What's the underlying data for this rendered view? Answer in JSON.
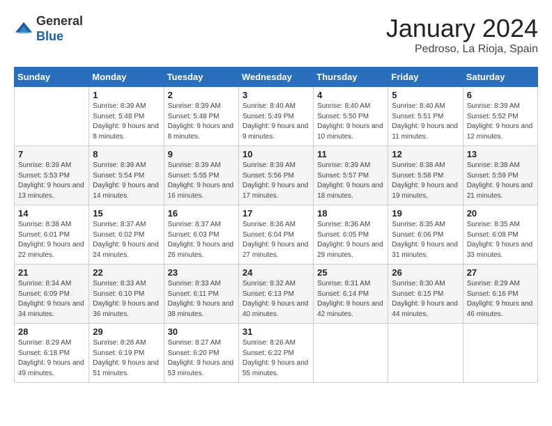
{
  "header": {
    "logo_general": "General",
    "logo_blue": "Blue",
    "month_title": "January 2024",
    "location": "Pedroso, La Rioja, Spain"
  },
  "days_of_week": [
    "Sunday",
    "Monday",
    "Tuesday",
    "Wednesday",
    "Thursday",
    "Friday",
    "Saturday"
  ],
  "weeks": [
    [
      {
        "day": "",
        "empty": true
      },
      {
        "day": "1",
        "sunrise": "Sunrise: 8:39 AM",
        "sunset": "Sunset: 5:48 PM",
        "daylight": "Daylight: 9 hours and 8 minutes."
      },
      {
        "day": "2",
        "sunrise": "Sunrise: 8:39 AM",
        "sunset": "Sunset: 5:48 PM",
        "daylight": "Daylight: 9 hours and 8 minutes."
      },
      {
        "day": "3",
        "sunrise": "Sunrise: 8:40 AM",
        "sunset": "Sunset: 5:49 PM",
        "daylight": "Daylight: 9 hours and 9 minutes."
      },
      {
        "day": "4",
        "sunrise": "Sunrise: 8:40 AM",
        "sunset": "Sunset: 5:50 PM",
        "daylight": "Daylight: 9 hours and 10 minutes."
      },
      {
        "day": "5",
        "sunrise": "Sunrise: 8:40 AM",
        "sunset": "Sunset: 5:51 PM",
        "daylight": "Daylight: 9 hours and 11 minutes."
      },
      {
        "day": "6",
        "sunrise": "Sunrise: 8:39 AM",
        "sunset": "Sunset: 5:52 PM",
        "daylight": "Daylight: 9 hours and 12 minutes."
      }
    ],
    [
      {
        "day": "7",
        "sunrise": "Sunrise: 8:39 AM",
        "sunset": "Sunset: 5:53 PM",
        "daylight": "Daylight: 9 hours and 13 minutes."
      },
      {
        "day": "8",
        "sunrise": "Sunrise: 8:39 AM",
        "sunset": "Sunset: 5:54 PM",
        "daylight": "Daylight: 9 hours and 14 minutes."
      },
      {
        "day": "9",
        "sunrise": "Sunrise: 8:39 AM",
        "sunset": "Sunset: 5:55 PM",
        "daylight": "Daylight: 9 hours and 16 minutes."
      },
      {
        "day": "10",
        "sunrise": "Sunrise: 8:39 AM",
        "sunset": "Sunset: 5:56 PM",
        "daylight": "Daylight: 9 hours and 17 minutes."
      },
      {
        "day": "11",
        "sunrise": "Sunrise: 8:39 AM",
        "sunset": "Sunset: 5:57 PM",
        "daylight": "Daylight: 9 hours and 18 minutes."
      },
      {
        "day": "12",
        "sunrise": "Sunrise: 8:38 AM",
        "sunset": "Sunset: 5:58 PM",
        "daylight": "Daylight: 9 hours and 19 minutes."
      },
      {
        "day": "13",
        "sunrise": "Sunrise: 8:38 AM",
        "sunset": "Sunset: 5:59 PM",
        "daylight": "Daylight: 9 hours and 21 minutes."
      }
    ],
    [
      {
        "day": "14",
        "sunrise": "Sunrise: 8:38 AM",
        "sunset": "Sunset: 6:01 PM",
        "daylight": "Daylight: 9 hours and 22 minutes."
      },
      {
        "day": "15",
        "sunrise": "Sunrise: 8:37 AM",
        "sunset": "Sunset: 6:02 PM",
        "daylight": "Daylight: 9 hours and 24 minutes."
      },
      {
        "day": "16",
        "sunrise": "Sunrise: 8:37 AM",
        "sunset": "Sunset: 6:03 PM",
        "daylight": "Daylight: 9 hours and 26 minutes."
      },
      {
        "day": "17",
        "sunrise": "Sunrise: 8:36 AM",
        "sunset": "Sunset: 6:04 PM",
        "daylight": "Daylight: 9 hours and 27 minutes."
      },
      {
        "day": "18",
        "sunrise": "Sunrise: 8:36 AM",
        "sunset": "Sunset: 6:05 PM",
        "daylight": "Daylight: 9 hours and 29 minutes."
      },
      {
        "day": "19",
        "sunrise": "Sunrise: 8:35 AM",
        "sunset": "Sunset: 6:06 PM",
        "daylight": "Daylight: 9 hours and 31 minutes."
      },
      {
        "day": "20",
        "sunrise": "Sunrise: 8:35 AM",
        "sunset": "Sunset: 6:08 PM",
        "daylight": "Daylight: 9 hours and 33 minutes."
      }
    ],
    [
      {
        "day": "21",
        "sunrise": "Sunrise: 8:34 AM",
        "sunset": "Sunset: 6:09 PM",
        "daylight": "Daylight: 9 hours and 34 minutes."
      },
      {
        "day": "22",
        "sunrise": "Sunrise: 8:33 AM",
        "sunset": "Sunset: 6:10 PM",
        "daylight": "Daylight: 9 hours and 36 minutes."
      },
      {
        "day": "23",
        "sunrise": "Sunrise: 8:33 AM",
        "sunset": "Sunset: 6:11 PM",
        "daylight": "Daylight: 9 hours and 38 minutes."
      },
      {
        "day": "24",
        "sunrise": "Sunrise: 8:32 AM",
        "sunset": "Sunset: 6:13 PM",
        "daylight": "Daylight: 9 hours and 40 minutes."
      },
      {
        "day": "25",
        "sunrise": "Sunrise: 8:31 AM",
        "sunset": "Sunset: 6:14 PM",
        "daylight": "Daylight: 9 hours and 42 minutes."
      },
      {
        "day": "26",
        "sunrise": "Sunrise: 8:30 AM",
        "sunset": "Sunset: 6:15 PM",
        "daylight": "Daylight: 9 hours and 44 minutes."
      },
      {
        "day": "27",
        "sunrise": "Sunrise: 8:29 AM",
        "sunset": "Sunset: 6:16 PM",
        "daylight": "Daylight: 9 hours and 46 minutes."
      }
    ],
    [
      {
        "day": "28",
        "sunrise": "Sunrise: 8:29 AM",
        "sunset": "Sunset: 6:18 PM",
        "daylight": "Daylight: 9 hours and 49 minutes."
      },
      {
        "day": "29",
        "sunrise": "Sunrise: 8:28 AM",
        "sunset": "Sunset: 6:19 PM",
        "daylight": "Daylight: 9 hours and 51 minutes."
      },
      {
        "day": "30",
        "sunrise": "Sunrise: 8:27 AM",
        "sunset": "Sunset: 6:20 PM",
        "daylight": "Daylight: 9 hours and 53 minutes."
      },
      {
        "day": "31",
        "sunrise": "Sunrise: 8:26 AM",
        "sunset": "Sunset: 6:22 PM",
        "daylight": "Daylight: 9 hours and 55 minutes."
      },
      {
        "day": "",
        "empty": true
      },
      {
        "day": "",
        "empty": true
      },
      {
        "day": "",
        "empty": true
      }
    ]
  ]
}
